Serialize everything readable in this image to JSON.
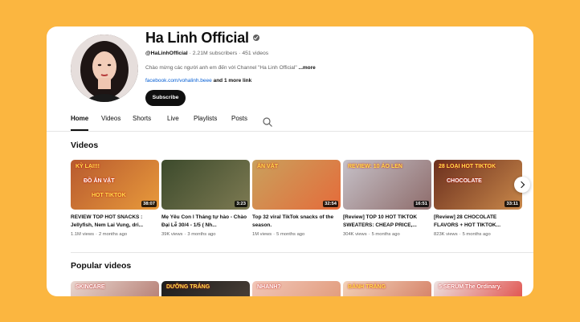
{
  "channel": {
    "name": "Ha Linh Official",
    "handle": "@HaLinhOfficial",
    "subscribers": "2.21M subscribers",
    "videos": "451 videos",
    "separator": "·",
    "description": "Chào mừng các người anh em đến với Channel \"Ha Linh Official\"",
    "more": "...more",
    "link": "facebook.com/vohalinh.beee",
    "more_links": "and 1 more link",
    "subscribe": "Subscribe"
  },
  "tabs": [
    {
      "label": "Home"
    },
    {
      "label": "Videos"
    },
    {
      "label": "Shorts"
    },
    {
      "label": "Live"
    },
    {
      "label": "Playlists"
    },
    {
      "label": "Posts"
    }
  ],
  "sections": {
    "videos": "Videos",
    "popular": "Popular videos"
  },
  "videos": [
    {
      "title": "REVIEW TOP HOT SNACKS : Jellyfish, Nem Lai Vung, dri...",
      "views": "1.1M views",
      "age": "2 months ago",
      "duration": "38:07",
      "overlay": [
        "KỲ LẠI!!!",
        "ĐỒ ĂN VẶT",
        "HOT TIKTOK"
      ],
      "colors": [
        "#b85a2f",
        "#e89a3b"
      ]
    },
    {
      "title": "Mẹ Yêu Con l Tháng tự hào - Chào Đại Lễ 30/4 - 1/5 ( Nh...",
      "views": "39K views",
      "age": "3 months ago",
      "duration": "3:23",
      "overlay": [],
      "colors": [
        "#3c4a2c",
        "#7d7a52"
      ]
    },
    {
      "title": "Top 32 viral TikTok snacks of the season.",
      "views": "1M views",
      "age": "5 months ago",
      "duration": "32:54",
      "overlay": [
        "ĂN VẶT"
      ],
      "colors": [
        "#c9a15d",
        "#e56b3a"
      ]
    },
    {
      "title": "[Review] TOP 10 HOT TIKTOK SWEATERS: CHEAP PRICE,...",
      "views": "304K views",
      "age": "5 months ago",
      "duration": "16:51",
      "overlay": [
        "REVIEW: 10 ÁO LEN"
      ],
      "colors": [
        "#c6c1c8",
        "#8e6c6b"
      ]
    },
    {
      "title": "[Review] 28 CHOCOLATE FLAVORS + HOT TIKTOK...",
      "views": "823K views",
      "age": "5 months ago",
      "duration": "33:11",
      "overlay": [
        "28 LOẠI HOT TIKTOK",
        "CHOCOLATE"
      ],
      "colors": [
        "#6b2f1e",
        "#c9884a"
      ]
    }
  ],
  "popular": [
    {
      "overlay": "SKINCARE",
      "colors": [
        "#e9d6cf",
        "#b47c72"
      ]
    },
    {
      "overlay": "DƯỠNG TRẮNG",
      "colors": [
        "#1d1d1d",
        "#4a4038"
      ]
    },
    {
      "overlay": "NHANH?",
      "colors": [
        "#f1c6b8",
        "#e19a7a"
      ]
    },
    {
      "overlay": "BÁNH TRÁNG",
      "colors": [
        "#f3d2b9",
        "#d47e64"
      ]
    },
    {
      "overlay": "5 SERUM The Ordinary.",
      "colors": [
        "#ede4e3",
        "#e04b46"
      ]
    }
  ]
}
